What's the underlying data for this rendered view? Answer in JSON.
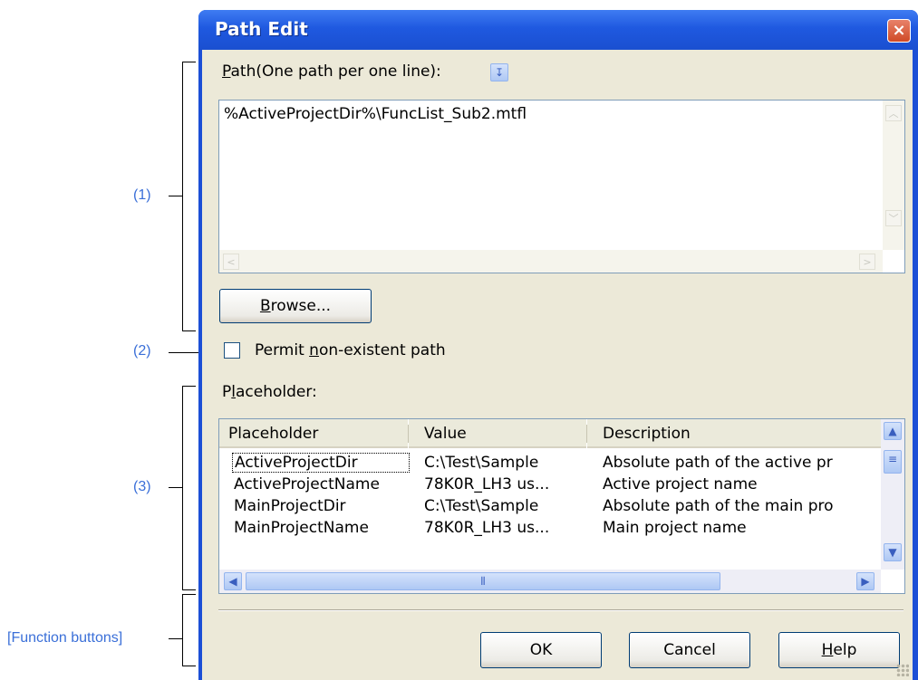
{
  "annotations": {
    "a1": "(1)",
    "a2": "(2)",
    "a3": "(3)",
    "a4": "[Function buttons]"
  },
  "window": {
    "title": "Path Edit"
  },
  "path": {
    "label": "ath(One path per one line):",
    "label_mnemonic": "P",
    "value": "%ActiveProjectDir%\\FuncList_Sub2.mtfl"
  },
  "browse": {
    "mnemonic": "B",
    "rest": "rowse..."
  },
  "permit": {
    "pre": "Permit ",
    "mnemonic": "n",
    "post": "on-existent path",
    "checked": false
  },
  "placeholder": {
    "label_pre": "P",
    "label_mnemonic": "l",
    "label_post": "aceholder:",
    "columns": [
      "Placeholder",
      "Value",
      "Description"
    ],
    "rows": [
      [
        "ActiveProjectDir",
        "C:\\Test\\Sample",
        "Absolute path of the active pr"
      ],
      [
        "ActiveProjectName",
        "78K0R_LH3 us...",
        "Active project name"
      ],
      [
        "MainProjectDir",
        "C:\\Test\\Sample",
        "Absolute path of the main pro"
      ],
      [
        "MainProjectName",
        "78K0R_LH3 us...",
        "Main project name"
      ]
    ]
  },
  "buttons": {
    "ok": "OK",
    "cancel": "Cancel",
    "help_mnemonic": "H",
    "help_rest": "elp"
  }
}
